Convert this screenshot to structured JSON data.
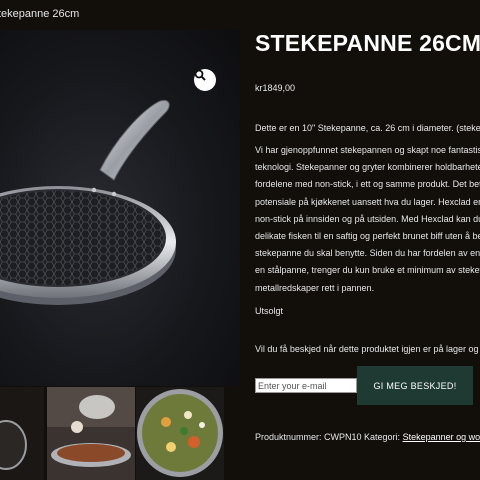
{
  "breadcrumb": "tekepanne 26cm",
  "product": {
    "title": "STEKEPANNE 26CM",
    "price": "kr1849,00",
    "description_intro": "Dette er en 10\" Stekepanne, ca. 26 cm i diameter. (stekefl",
    "description_lines": [
      "Vi har gjenoppfunnet stekepannen og skapt noe fantastis",
      "teknologi. Stekepanner og gryter kombinerer holdbarhete",
      "fordelene med non-stick, i ett og samme produkt. Det bet",
      "potensiale på kjøkkenet uansett hva du lager. Hexclad er",
      "non-stick på innsiden og på utsiden. Med Hexclad kan du",
      "delikate fisken til en saftig og perfekt brunet biff uten å be",
      "stekepanne du skal benytte. Siden du har fordelen av en v",
      "en stålpanne, trenger du kun bruke et minimum av stekef",
      "metallredskaper rett i pannen."
    ],
    "stock_status": "Utsolgt",
    "notify_text": "Vil du få beskjed når dette produktet igjen er på lager og t",
    "email_placeholder": "Enter your e-mail",
    "notify_button": "GI MEG BESKJED!",
    "meta_label": "Produktnummer: CWPN10 Kategori: ",
    "category_link": "Stekepanner og wok"
  },
  "icons": {
    "zoom": "magnifier-icon"
  },
  "colors": {
    "background": "#120f0b",
    "button": "#1e3a33"
  }
}
